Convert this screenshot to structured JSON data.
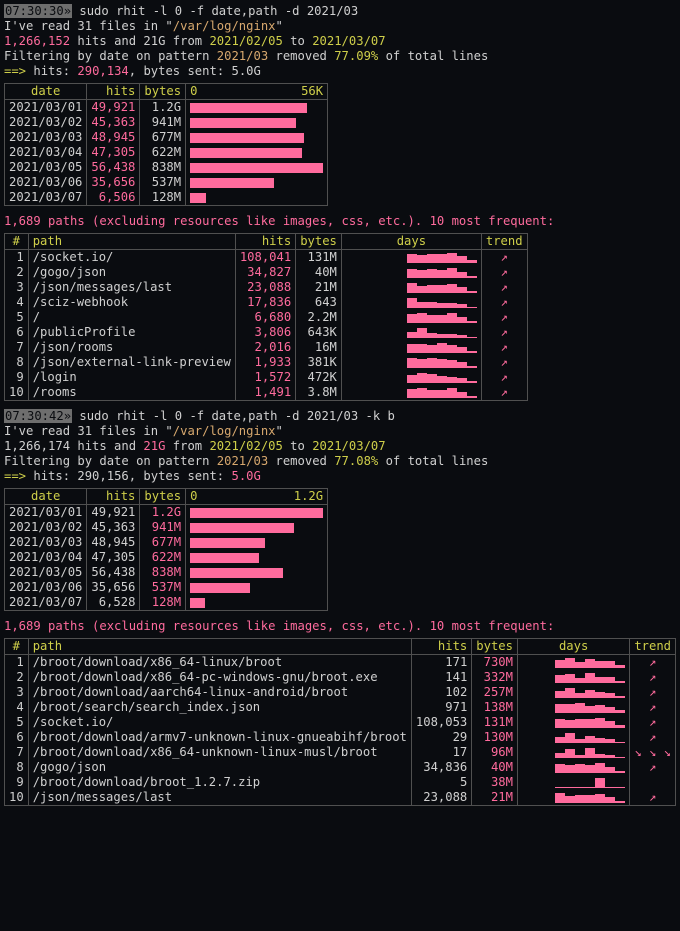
{
  "run1": {
    "timestamp": "07:30:30»",
    "cmd": " sudo rhit -l 0 -f date,path -d 2021/03",
    "read_line_a": "I've read 31 files in \"",
    "log_path": "/var/log/nginx",
    "read_line_b": "\"",
    "total_hits": "1,266,152",
    "hits_and": " hits and 21G from ",
    "date_from": "2021/02/05",
    "to": " to ",
    "date_to": "2021/03/07",
    "filter_a": "Filtering by date on pattern ",
    "pattern": "2021/03",
    "removed": " removed ",
    "pct": "77.09%",
    "of_lines": " of total lines",
    "arrow": "==> ",
    "hits_lbl": "hits: ",
    "hits_val": "290,134",
    "bytes_sent": ", bytes sent: 5.0G",
    "date_header": {
      "date": "date",
      "hits": "hits",
      "bytes": "bytes",
      "scale_l": "0",
      "scale_r": "56K"
    },
    "date_rows": [
      {
        "date": "2021/03/01",
        "hits": "49,921",
        "bytes": "1.2G",
        "bar": 88
      },
      {
        "date": "2021/03/02",
        "hits": "45,363",
        "bytes": "941M",
        "bar": 80
      },
      {
        "date": "2021/03/03",
        "hits": "48,945",
        "bytes": "677M",
        "bar": 86
      },
      {
        "date": "2021/03/04",
        "hits": "47,305",
        "bytes": "622M",
        "bar": 84
      },
      {
        "date": "2021/03/05",
        "hits": "56,438",
        "bytes": "838M",
        "bar": 100
      },
      {
        "date": "2021/03/06",
        "hits": "35,656",
        "bytes": "537M",
        "bar": 63
      },
      {
        "date": "2021/03/07",
        "hits": "6,506",
        "bytes": "128M",
        "bar": 12
      }
    ],
    "paths_summary": "1,689 paths (excluding resources like images, css, etc.). 10 most frequent:",
    "path_header": {
      "idx": "#",
      "path": "path",
      "hits": "hits",
      "bytes": "bytes",
      "days": "days",
      "trend": "trend"
    },
    "path_rows": [
      {
        "i": "1",
        "path": "/socket.io/",
        "hits": "108,041",
        "bytes": "131M",
        "bars": [
          90,
          80,
          90,
          85,
          100,
          70,
          25
        ],
        "trend": "↗"
      },
      {
        "i": "2",
        "path": "/gogo/json",
        "hits": "34,827",
        "bytes": "40M",
        "bars": [
          85,
          75,
          85,
          80,
          100,
          60,
          20
        ],
        "trend": "↗"
      },
      {
        "i": "3",
        "path": "/json/messages/last",
        "hits": "23,088",
        "bytes": "21M",
        "bars": [
          100,
          70,
          80,
          75,
          85,
          55,
          15
        ],
        "trend": "↗"
      },
      {
        "i": "4",
        "path": "/sciz-webhook",
        "hits": "17,836",
        "bytes": "643",
        "bars": [
          100,
          60,
          55,
          50,
          45,
          40,
          10
        ],
        "trend": "↗"
      },
      {
        "i": "5",
        "path": "/",
        "hits": "6,680",
        "bytes": "2.2M",
        "bars": [
          85,
          95,
          80,
          75,
          100,
          55,
          20
        ],
        "trend": "↗"
      },
      {
        "i": "6",
        "path": "/publicProfile",
        "hits": "3,806",
        "bytes": "643K",
        "bars": [
          60,
          100,
          50,
          40,
          35,
          25,
          10
        ],
        "trend": "↗"
      },
      {
        "i": "7",
        "path": "/json/rooms",
        "hits": "2,016",
        "bytes": "16M",
        "bars": [
          90,
          85,
          80,
          100,
          75,
          60,
          20
        ],
        "trend": "↗"
      },
      {
        "i": "8",
        "path": "/json/external-link-preview",
        "hits": "1,933",
        "bytes": "381K",
        "bars": [
          95,
          90,
          100,
          85,
          80,
          60,
          15
        ],
        "trend": "↗"
      },
      {
        "i": "9",
        "path": "/login",
        "hits": "1,572",
        "bytes": "472K",
        "bars": [
          80,
          100,
          85,
          70,
          60,
          45,
          15
        ],
        "trend": "↗"
      },
      {
        "i": "10",
        "path": "/rooms",
        "hits": "1,491",
        "bytes": "3.8M",
        "bars": [
          85,
          95,
          80,
          75,
          100,
          55,
          20
        ],
        "trend": "↗"
      }
    ]
  },
  "run2": {
    "timestamp": "07:30:42»",
    "cmd": " sudo rhit -l 0 -f date,path -d 2021/03 -k b",
    "read_line_a": "I've read 31 files in \"",
    "log_path": "/var/log/nginx",
    "read_line_b": "\"",
    "total_hits": "1,266,174 hits and ",
    "size": "21G",
    "from": " from ",
    "date_from": "2021/02/05",
    "to": " to ",
    "date_to": "2021/03/07",
    "filter_a": "Filtering by date on pattern ",
    "pattern": "2021/03",
    "removed": " removed ",
    "pct": "77.08%",
    "of_lines": " of total lines",
    "arrow": "==> ",
    "hits": "hits: 290,156, bytes sent: ",
    "bytes_sent": "5.0G",
    "date_header": {
      "date": "date",
      "hits": "hits",
      "bytes": "bytes",
      "scale_l": "0",
      "scale_r": "1.2G"
    },
    "date_rows": [
      {
        "date": "2021/03/01",
        "hits": "49,921",
        "bytes": "1.2G",
        "bar": 100
      },
      {
        "date": "2021/03/02",
        "hits": "45,363",
        "bytes": "941M",
        "bar": 78
      },
      {
        "date": "2021/03/03",
        "hits": "48,945",
        "bytes": "677M",
        "bar": 56
      },
      {
        "date": "2021/03/04",
        "hits": "47,305",
        "bytes": "622M",
        "bar": 52
      },
      {
        "date": "2021/03/05",
        "hits": "56,438",
        "bytes": "838M",
        "bar": 70
      },
      {
        "date": "2021/03/06",
        "hits": "35,656",
        "bytes": "537M",
        "bar": 45
      },
      {
        "date": "2021/03/07",
        "hits": "6,528",
        "bytes": "128M",
        "bar": 11
      }
    ],
    "paths_summary": "1,689 paths (excluding resources like images, css, etc.). 10 most frequent:",
    "path_header": {
      "idx": "#",
      "path": "path",
      "hits": "hits",
      "bytes": "bytes",
      "days": "days",
      "trend": "trend"
    },
    "path_rows": [
      {
        "i": "1",
        "path": "/broot/download/x86_64-linux/broot",
        "hits": "171",
        "bytes": "730M",
        "bars": [
          80,
          100,
          60,
          90,
          70,
          65,
          25
        ],
        "trend": "↗",
        "tc": "pink"
      },
      {
        "i": "2",
        "path": "/broot/download/x86_64-pc-windows-gnu/broot.exe",
        "hits": "141",
        "bytes": "332M",
        "bars": [
          75,
          85,
          50,
          100,
          60,
          55,
          20
        ],
        "trend": "↗",
        "tc": "pink"
      },
      {
        "i": "3",
        "path": "/broot/download/aarch64-linux-android/broot",
        "hits": "102",
        "bytes": "257M",
        "bars": [
          65,
          100,
          45,
          80,
          55,
          50,
          15
        ],
        "trend": "↗",
        "tc": "pink"
      },
      {
        "i": "4",
        "path": "/broot/search/search_index.json",
        "hits": "971",
        "bytes": "138M",
        "bars": [
          90,
          85,
          100,
          70,
          80,
          60,
          30
        ],
        "trend": "↗",
        "tc": "pink"
      },
      {
        "i": "5",
        "path": "/socket.io/",
        "hits": "108,053",
        "bytes": "131M",
        "bars": [
          90,
          80,
          90,
          85,
          100,
          70,
          25
        ],
        "trend": "↗",
        "tc": "pink"
      },
      {
        "i": "6",
        "path": "/broot/download/armv7-unknown-linux-gnueabihf/broot",
        "hits": "29",
        "bytes": "130M",
        "bars": [
          60,
          100,
          40,
          70,
          45,
          35,
          10
        ],
        "trend": "↗",
        "tc": "pink"
      },
      {
        "i": "7",
        "path": "/broot/download/x86_64-unknown-linux-musl/broot",
        "hits": "17",
        "bytes": "96M",
        "bars": [
          50,
          90,
          30,
          100,
          35,
          25,
          8
        ],
        "trend": "↘ ↘ ↘",
        "tc": "pink"
      },
      {
        "i": "8",
        "path": "/gogo/json",
        "hits": "34,836",
        "bytes": "40M",
        "bars": [
          85,
          75,
          85,
          80,
          100,
          60,
          20
        ],
        "trend": "↗",
        "tc": "pink"
      },
      {
        "i": "9",
        "path": "/broot/download/broot_1.2.7.zip",
        "hits": "5",
        "bytes": "38M",
        "bars": [
          0,
          0,
          0,
          0,
          100,
          0,
          0
        ],
        "trend": "",
        "tc": "pink"
      },
      {
        "i": "10",
        "path": "/json/messages/last",
        "hits": "23,088",
        "bytes": "21M",
        "bars": [
          100,
          70,
          80,
          75,
          85,
          55,
          15
        ],
        "trend": "↗",
        "tc": "pink"
      }
    ]
  }
}
